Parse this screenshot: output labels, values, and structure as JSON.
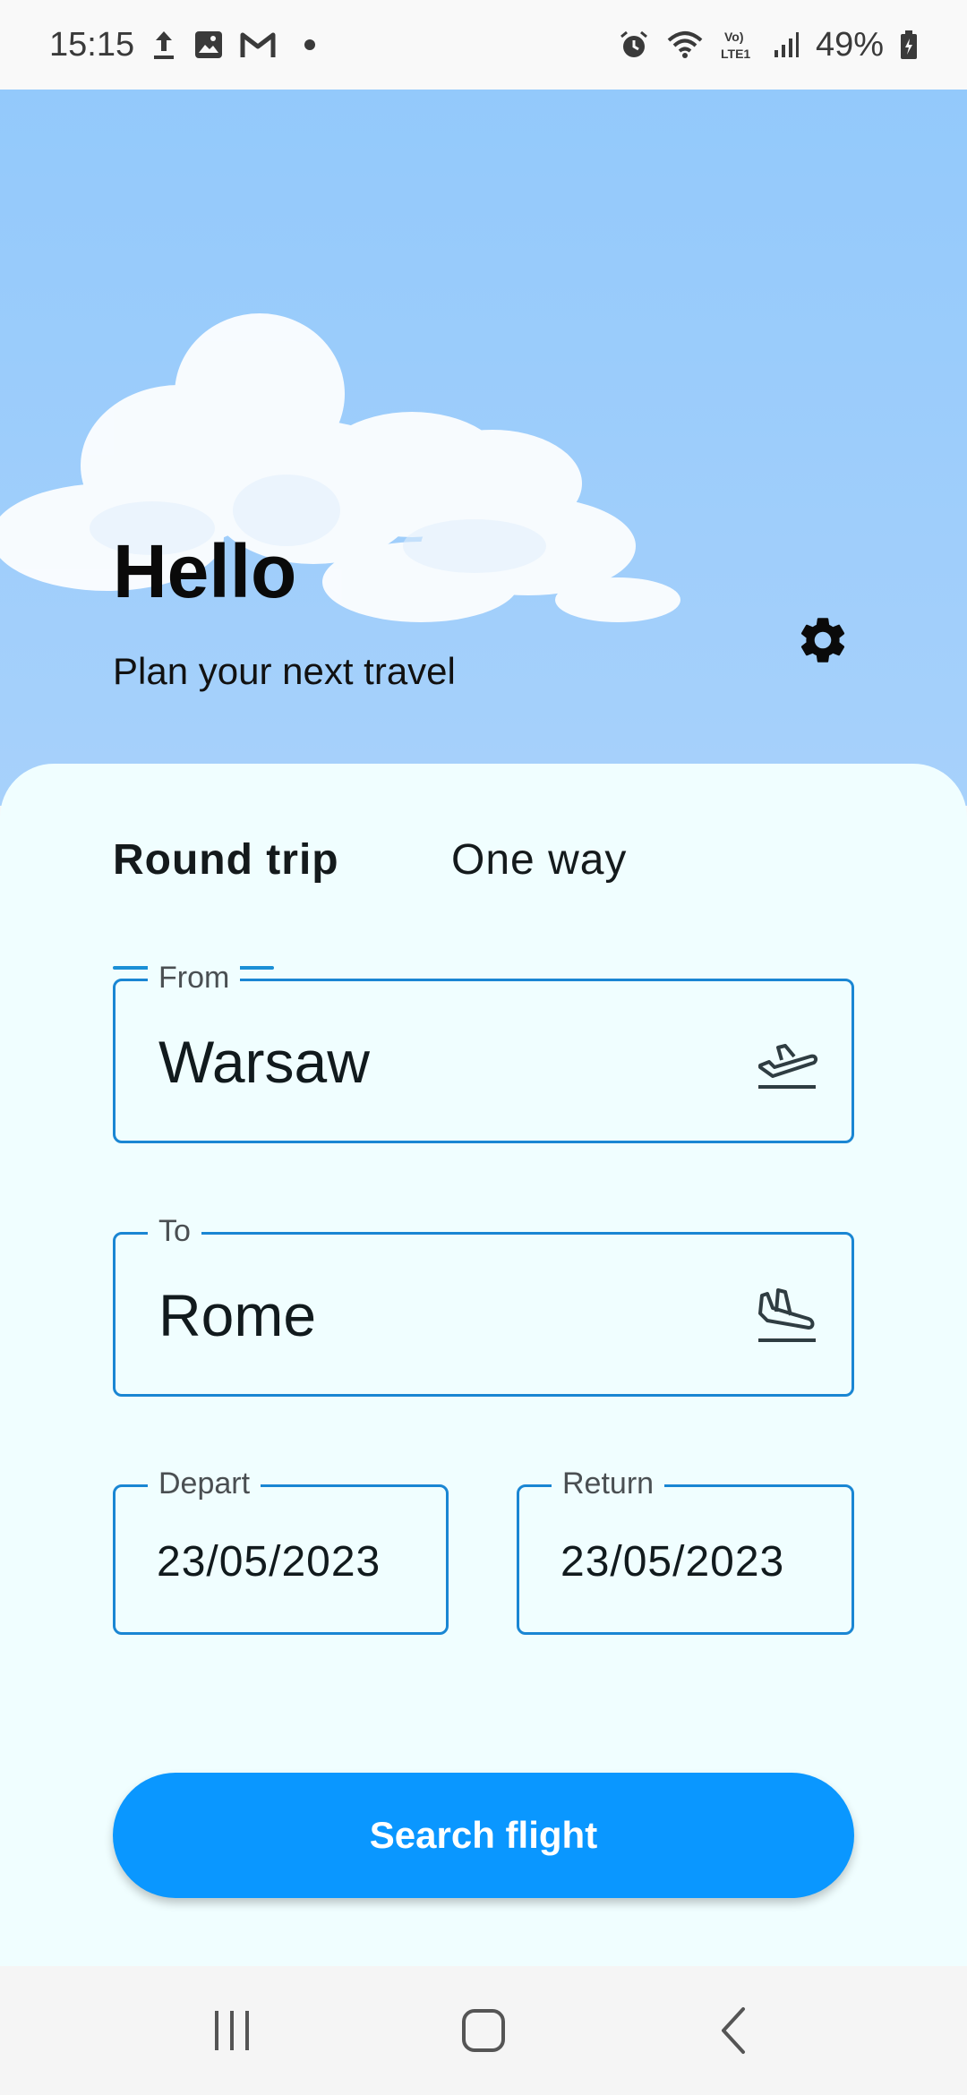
{
  "status_bar": {
    "time": "15:15",
    "left_icons": [
      "upload-icon",
      "gallery-icon",
      "gmail-icon",
      "dot-icon"
    ],
    "right_icons": [
      "alarm-icon",
      "wifi-icon",
      "volte-icon",
      "signal-icon",
      "battery-icon"
    ],
    "battery": "49%"
  },
  "hero": {
    "title": "Hello",
    "subtitle": "Plan your next travel",
    "settings_icon": "gear-icon"
  },
  "tabs": [
    {
      "label": "Round trip",
      "selected": true
    },
    {
      "label": "One way",
      "selected": false
    }
  ],
  "form": {
    "from": {
      "label": "From",
      "value": "Warsaw",
      "icon": "plane-takeoff-icon"
    },
    "to": {
      "label": "To",
      "value": "Rome",
      "icon": "plane-landing-icon"
    },
    "depart": {
      "label": "Depart",
      "value": "23/05/2023"
    },
    "return": {
      "label": "Return",
      "value": "23/05/2023"
    }
  },
  "search_button": {
    "label": "Search flight"
  },
  "nav_bar": {
    "items": [
      "recent-apps-icon",
      "home-icon",
      "back-icon"
    ]
  },
  "colors": {
    "accent": "#0a97ff",
    "field_border": "#1a86d3",
    "sky": "#93c9fb",
    "sheet": "#f0feff"
  }
}
